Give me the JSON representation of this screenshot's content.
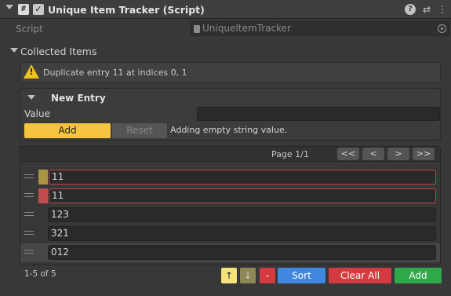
{
  "header": {
    "script_icon_glyph": "#",
    "check_glyph": "✓",
    "title": "Unique Item Tracker (Script)",
    "help_glyph": "?",
    "preset_glyph": "⇄",
    "menu_glyph": "⋮"
  },
  "script_row": {
    "label": "Script",
    "value": "UniqueItemTracker"
  },
  "collected": {
    "label": "Collected Items",
    "warning": "Duplicate entry 11 at indices 0, 1",
    "warning_glyph": "!"
  },
  "new_entry": {
    "title": "New Entry",
    "value_label": "Value",
    "value": "",
    "add_label": "Add",
    "reset_label": "Reset",
    "status": "Adding empty string value."
  },
  "list": {
    "page_label": "Page 1/1",
    "nav": {
      "first": "<<",
      "prev": "<",
      "next": ">",
      "last": ">>"
    },
    "items": [
      "11",
      "11",
      "123",
      "321",
      "012"
    ],
    "count_label": "1-5 of 5"
  },
  "footer": {
    "up_glyph": "↑",
    "down_glyph": "↓",
    "remove_glyph": "-",
    "sort_label": "Sort",
    "clear_label": "Clear All",
    "add_label": "Add"
  },
  "colors": {
    "accent_yellow": "#f5c542",
    "error_red": "#c04545",
    "sort_blue": "#3f87e0",
    "clear_red": "#d23b3f",
    "add_green": "#2ea84a"
  }
}
